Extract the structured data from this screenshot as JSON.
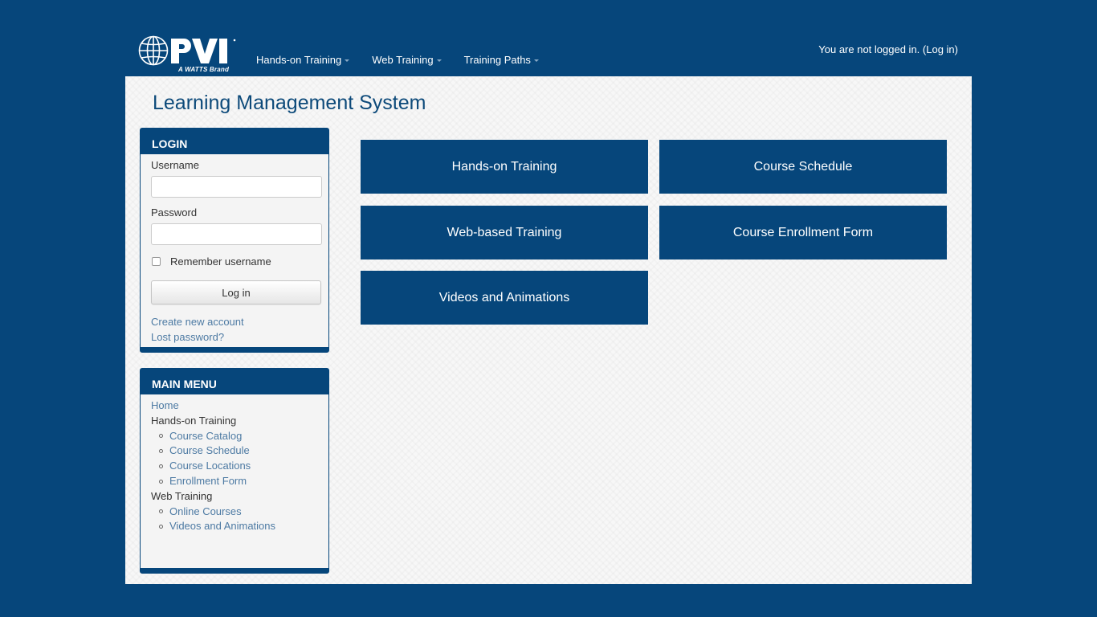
{
  "header": {
    "brand_tagline": "A WATTS Brand",
    "nav": [
      {
        "label": "Hands-on Training"
      },
      {
        "label": "Web Training"
      },
      {
        "label": "Training Paths"
      }
    ],
    "login_status_prefix": "You are not logged in. (",
    "login_link": "Log in",
    "login_status_suffix": ")"
  },
  "page": {
    "title": "Learning Management System"
  },
  "login_block": {
    "title": "LOGIN",
    "username_label": "Username",
    "username_value": "",
    "password_label": "Password",
    "password_value": "",
    "remember_label": "Remember username",
    "button_label": "Log in",
    "create_account": "Create new account",
    "lost_password": "Lost password?"
  },
  "main_menu": {
    "title": "MAIN MENU",
    "home": "Home",
    "sections": [
      {
        "label": "Hands-on Training",
        "items": [
          "Course Catalog",
          "Course Schedule",
          "Course Locations",
          "Enrollment Form"
        ]
      },
      {
        "label": "Web Training",
        "items": [
          "Online Courses",
          "Videos and Animations"
        ]
      }
    ]
  },
  "tiles": [
    {
      "label": "Hands-on Training"
    },
    {
      "label": "Course Schedule"
    },
    {
      "label": "Web-based Training"
    },
    {
      "label": "Course Enrollment Form"
    },
    {
      "label": "Videos and Animations"
    }
  ],
  "colors": {
    "primary": "#06467b",
    "link": "#4d7aa3",
    "title": "#0d4a7a"
  }
}
